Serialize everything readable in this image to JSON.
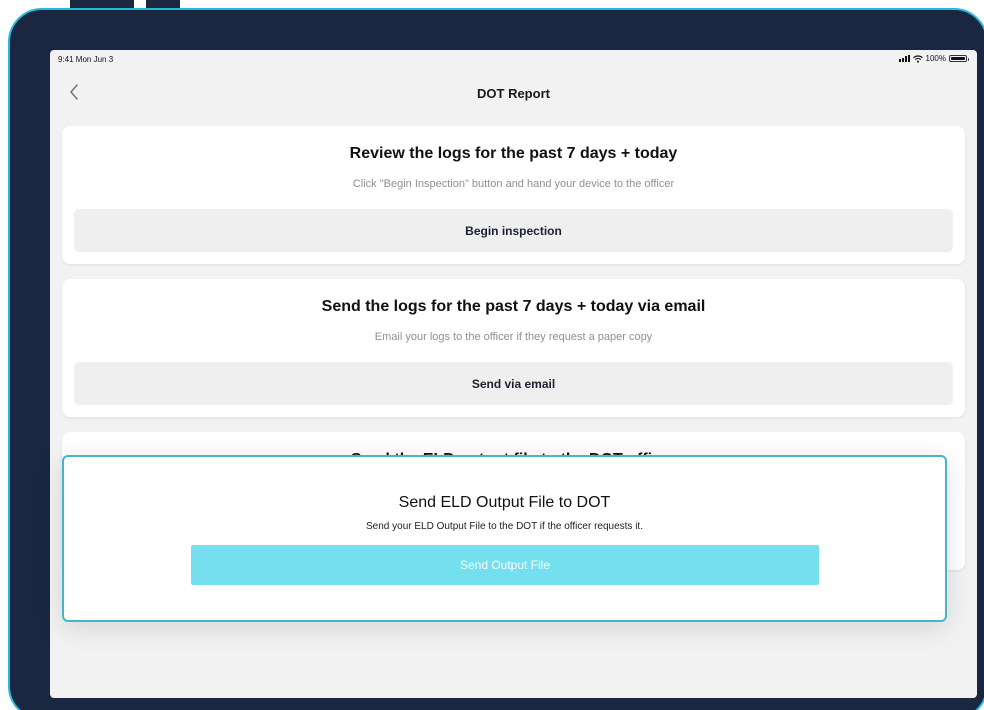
{
  "status_bar": {
    "time": "9:41 Mon Jun 3",
    "battery": "100%"
  },
  "nav": {
    "title": "DOT Report"
  },
  "cards": [
    {
      "title": "Review the logs for the past 7 days + today",
      "subtitle": "Click \"Begin Inspection\" button and hand your device to the officer",
      "button": "Begin inspection"
    },
    {
      "title": "Send the logs for the past 7 days + today via email",
      "subtitle": "Email your logs to the officer if they request a paper copy",
      "button": "Send via email"
    },
    {
      "title": "Send the ELD output file to the DOT officer"
    }
  ],
  "modal": {
    "title": "Send ELD Output File to DOT",
    "subtitle": "Send your ELD Output File to the DOT if the officer requests it.",
    "button": "Send Output File"
  },
  "colors": {
    "frame": "#1b2740",
    "frame_border": "#27b9dc",
    "modal_border": "#44b6cb",
    "modal_button": "#74dfef"
  }
}
